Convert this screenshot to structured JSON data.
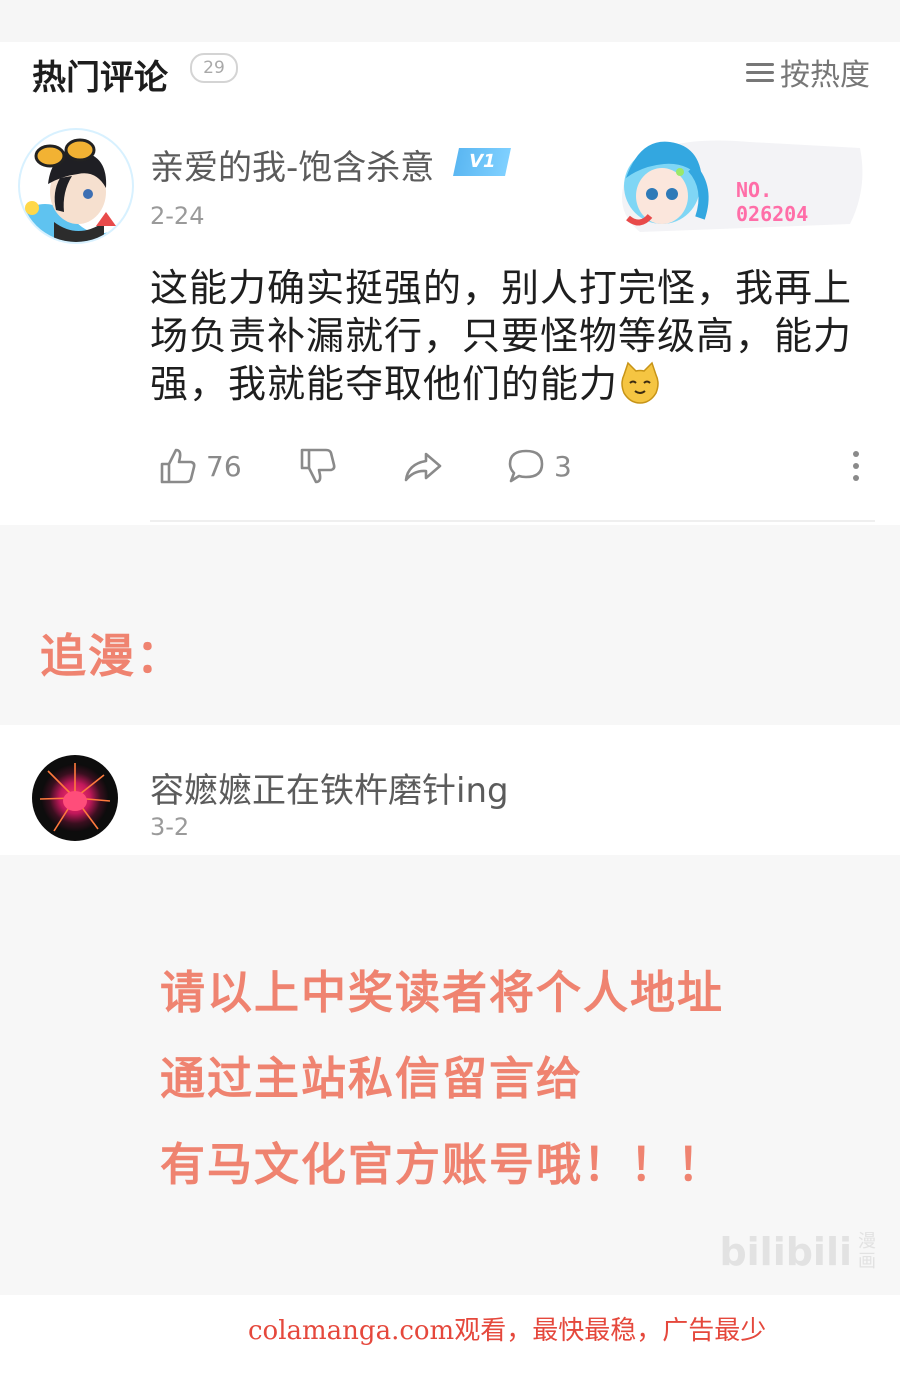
{
  "header": {
    "title": "热门评论",
    "count": "29",
    "sort_label": "按热度"
  },
  "comment1": {
    "username": "亲爱的我-饱含杀意",
    "level": "V1",
    "date": "2-24",
    "fan_badge_no_label": "NO.",
    "fan_badge_number": "026204",
    "text": "这能力确实挺强的，别人打完怪，我再上场负责补漏就行，只要怪物等级高，能力强，我就能夺取他们的能力",
    "likes": "76",
    "replies": "3"
  },
  "section_label": "追漫：",
  "comment2": {
    "username": "容嬷嬷正在铁杵磨针ing",
    "date": "3-2"
  },
  "notice": {
    "line1": "请以上中奖读者将个人地址",
    "line2": "通过主站私信留言给",
    "line3": "有马文化官方账号哦！！！"
  },
  "watermark": {
    "brand": "bilibili",
    "sub": "漫画"
  },
  "footer": {
    "text": "colamanga.com观看，最快最稳，广告最少"
  },
  "colors": {
    "accent": "#ef8370",
    "footer_red": "#e5483c",
    "level_blue": "#5bb7f2",
    "fan_pink": "#ff6ea8"
  }
}
